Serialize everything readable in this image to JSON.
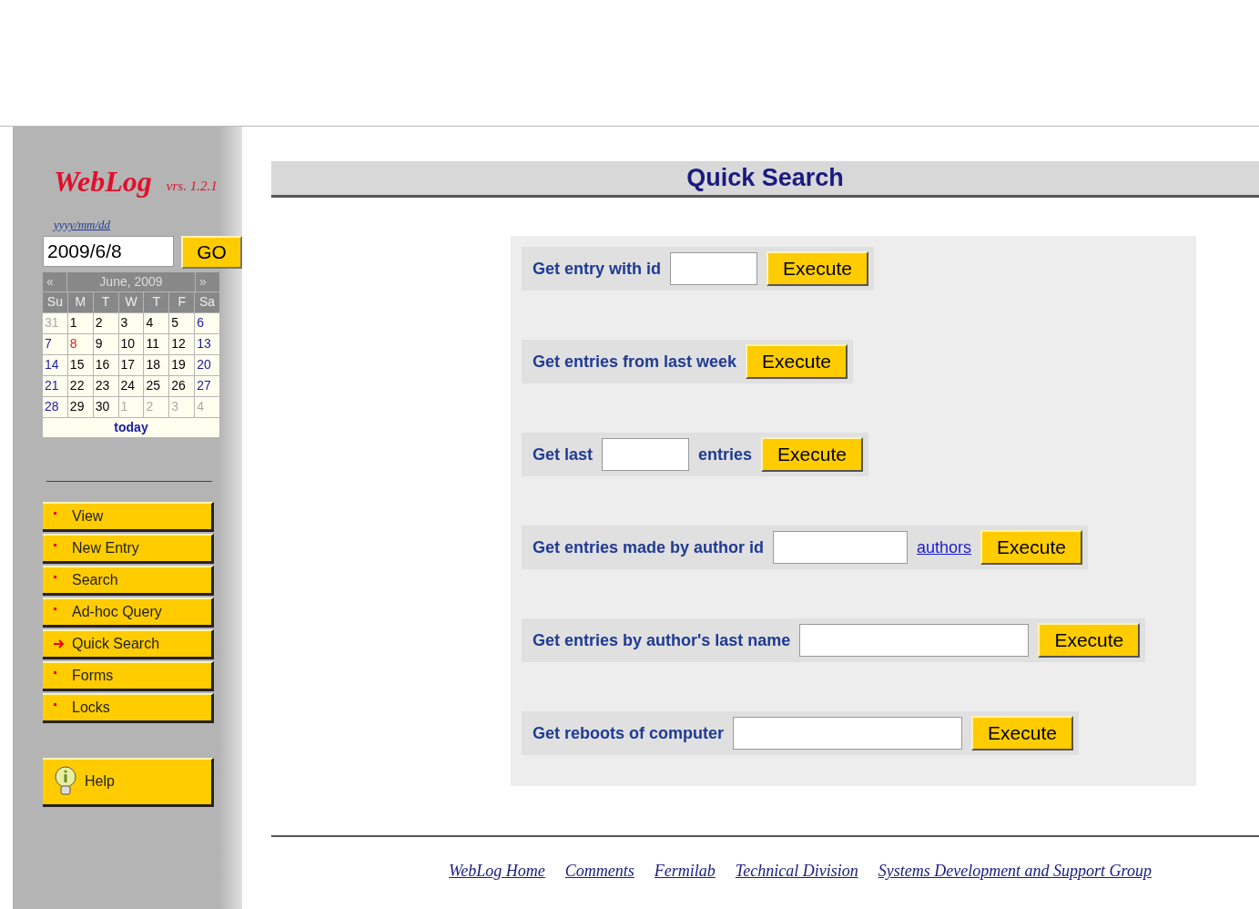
{
  "logo": {
    "name": "WebLog",
    "version": "vrs. 1.2.1"
  },
  "date_form": {
    "format_hint": "yyyy/mm/dd",
    "value": "2009/6/8",
    "button": "GO"
  },
  "calendar": {
    "prev": "«",
    "title": "June, 2009",
    "next": "»",
    "weekdays": [
      "Su",
      "M",
      "T",
      "W",
      "T",
      "F",
      "Sa"
    ],
    "weeks": [
      [
        {
          "day": "31",
          "kind": "other"
        },
        {
          "day": "1",
          "kind": "weekday"
        },
        {
          "day": "2",
          "kind": "weekday"
        },
        {
          "day": "3",
          "kind": "weekday"
        },
        {
          "day": "4",
          "kind": "weekday"
        },
        {
          "day": "5",
          "kind": "weekday"
        },
        {
          "day": "6",
          "kind": "weekend"
        }
      ],
      [
        {
          "day": "7",
          "kind": "weekend"
        },
        {
          "day": "8",
          "kind": "current"
        },
        {
          "day": "9",
          "kind": "weekday"
        },
        {
          "day": "10",
          "kind": "weekday"
        },
        {
          "day": "11",
          "kind": "weekday"
        },
        {
          "day": "12",
          "kind": "weekday"
        },
        {
          "day": "13",
          "kind": "weekend"
        }
      ],
      [
        {
          "day": "14",
          "kind": "weekend"
        },
        {
          "day": "15",
          "kind": "weekday"
        },
        {
          "day": "16",
          "kind": "weekday"
        },
        {
          "day": "17",
          "kind": "weekday"
        },
        {
          "day": "18",
          "kind": "weekday"
        },
        {
          "day": "19",
          "kind": "weekday"
        },
        {
          "day": "20",
          "kind": "weekend"
        }
      ],
      [
        {
          "day": "21",
          "kind": "weekend"
        },
        {
          "day": "22",
          "kind": "weekday"
        },
        {
          "day": "23",
          "kind": "weekday"
        },
        {
          "day": "24",
          "kind": "weekday"
        },
        {
          "day": "25",
          "kind": "weekday"
        },
        {
          "day": "26",
          "kind": "weekday"
        },
        {
          "day": "27",
          "kind": "weekend"
        }
      ],
      [
        {
          "day": "28",
          "kind": "weekend"
        },
        {
          "day": "29",
          "kind": "weekday"
        },
        {
          "day": "30",
          "kind": "weekday"
        },
        {
          "day": "1",
          "kind": "other"
        },
        {
          "day": "2",
          "kind": "other"
        },
        {
          "day": "3",
          "kind": "other"
        },
        {
          "day": "4",
          "kind": "other"
        }
      ]
    ],
    "today": "today"
  },
  "nav": [
    {
      "label": "View",
      "selected": false
    },
    {
      "label": "New Entry",
      "selected": false
    },
    {
      "label": "Search",
      "selected": false
    },
    {
      "label": "Ad-hoc Query",
      "selected": false
    },
    {
      "label": "Quick Search",
      "selected": true
    },
    {
      "label": "Forms",
      "selected": false
    },
    {
      "label": "Locks",
      "selected": false
    }
  ],
  "help": "Help",
  "title": "Quick Search",
  "queries": [
    {
      "parts": [
        {
          "kind": "label",
          "text": "Get entry with id"
        },
        {
          "kind": "shortfield"
        },
        {
          "kind": "button",
          "text": "Execute"
        }
      ]
    },
    {
      "parts": [
        {
          "kind": "label",
          "text": "Get entries from last week"
        },
        {
          "kind": "button",
          "text": "Execute"
        }
      ]
    },
    {
      "parts": [
        {
          "kind": "label",
          "text": "Get last"
        },
        {
          "kind": "shortfield"
        },
        {
          "kind": "label",
          "text": "entries"
        },
        {
          "kind": "button",
          "text": "Execute"
        }
      ]
    },
    {
      "parts": [
        {
          "kind": "label",
          "text": "Get entries made by author id"
        },
        {
          "kind": "field"
        },
        {
          "kind": "link",
          "text": "authors"
        },
        {
          "kind": "button",
          "text": "Execute"
        }
      ]
    },
    {
      "parts": [
        {
          "kind": "label",
          "text": "Get entries by author's last name"
        },
        {
          "kind": "longfield"
        },
        {
          "kind": "button",
          "text": "Execute"
        }
      ]
    },
    {
      "parts": [
        {
          "kind": "label",
          "text": "Get reboots of computer"
        },
        {
          "kind": "longfield"
        },
        {
          "kind": "button",
          "text": "Execute"
        }
      ]
    }
  ],
  "footer_links": [
    "WebLog Home",
    "Comments",
    "Fermilab",
    "Technical Division",
    "Systems Development and Support Group"
  ]
}
